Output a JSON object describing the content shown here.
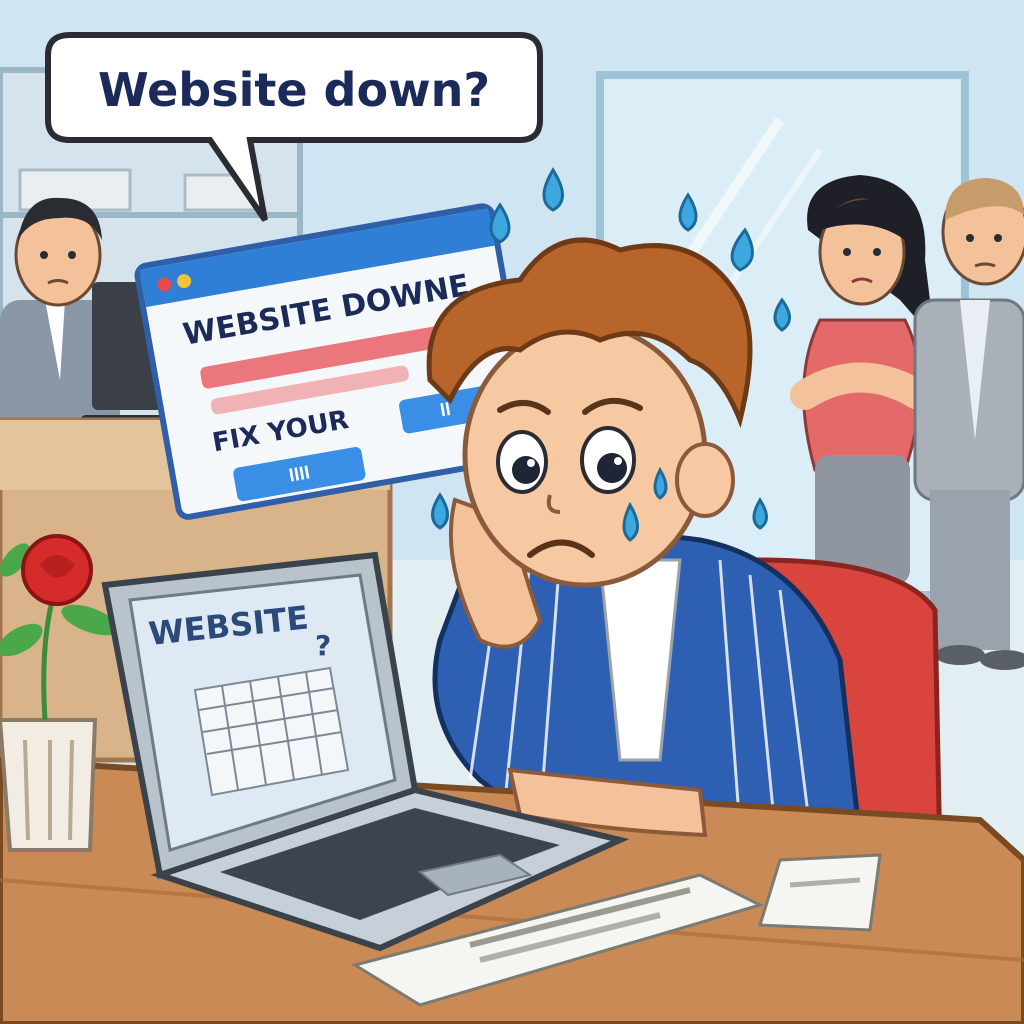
{
  "speech_bubble": {
    "text": "Website down?"
  },
  "popup_window": {
    "title": "WEBSITE DOWNE",
    "fix_text": "FIX YOUR",
    "button_left_label": "ꟾꟾꟾꟾ",
    "button_right_label": "ꟾꟾ"
  },
  "laptop_screen": {
    "title": "WEBSITE",
    "question_mark": "?"
  },
  "paper": {
    "text": ""
  },
  "colors": {
    "wall": "#cfe6f2",
    "desk": "#c98a55",
    "popup_bar": "#2f7fd6",
    "error_stripe": "#e8555b",
    "button_blue": "#3a8ee6",
    "chair_red": "#d9443f",
    "jacket_blue": "#2d5fb3",
    "hair_brown": "#b8652c",
    "tear_blue": "#3fa7e0",
    "flower_red": "#d62b2b"
  }
}
